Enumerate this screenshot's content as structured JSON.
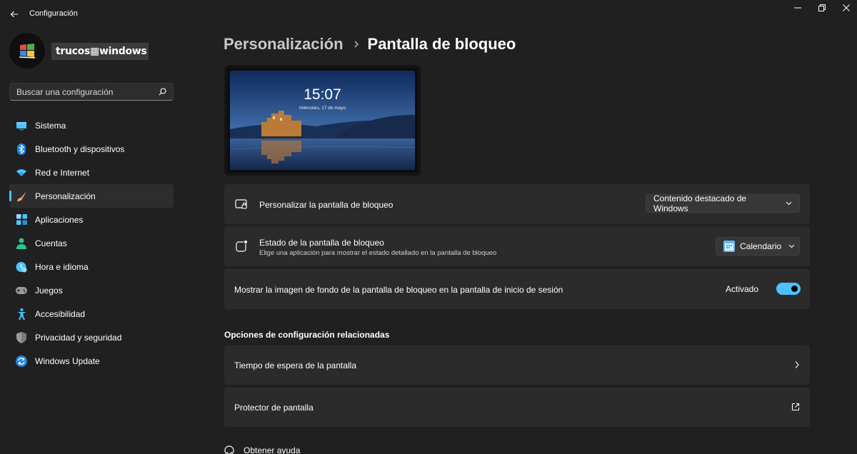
{
  "window": {
    "title": "Configuración",
    "back_icon": "back-arrow-icon",
    "controls": [
      "minimize-icon",
      "maximize-icon",
      "close-icon"
    ]
  },
  "profile": {
    "logo_text": "trucos▦windows"
  },
  "search": {
    "placeholder": "Buscar una configuración",
    "value": ""
  },
  "sidebar": {
    "accent_color": "#4cc2ff",
    "items": [
      {
        "label": "Sistema",
        "icon": "system-icon",
        "active": false
      },
      {
        "label": "Bluetooth y dispositivos",
        "icon": "bluetooth-icon",
        "active": false
      },
      {
        "label": "Red e Internet",
        "icon": "wifi-icon",
        "active": false
      },
      {
        "label": "Personalización",
        "icon": "brush-icon",
        "active": true
      },
      {
        "label": "Aplicaciones",
        "icon": "apps-icon",
        "active": false
      },
      {
        "label": "Cuentas",
        "icon": "accounts-icon",
        "active": false
      },
      {
        "label": "Hora e idioma",
        "icon": "time-language-icon",
        "active": false
      },
      {
        "label": "Juegos",
        "icon": "gamepad-icon",
        "active": false
      },
      {
        "label": "Accesibilidad",
        "icon": "accessibility-icon",
        "active": false
      },
      {
        "label": "Privacidad y seguridad",
        "icon": "shield-icon",
        "active": false
      },
      {
        "label": "Windows Update",
        "icon": "update-icon",
        "active": false
      }
    ]
  },
  "breadcrumb": {
    "parent": "Personalización",
    "current": "Pantalla de bloqueo"
  },
  "preview": {
    "time": "15:07",
    "date": "miércoles, 17 de mayo"
  },
  "settings": {
    "personalize": {
      "label": "Personalizar la pantalla de bloqueo",
      "value": "Contenido destacado de Windows"
    },
    "status": {
      "label": "Estado de la pantalla de bloqueo",
      "description": "Elige una aplicación para mostrar el estado detallado en la pantalla de bloqueo",
      "value": "Calendario"
    },
    "show_background": {
      "label": "Mostrar la imagen de fondo de la pantalla de bloqueo en la pantalla de inicio de sesión",
      "state_label": "Activado",
      "on": true
    }
  },
  "related": {
    "title": "Opciones de configuración relacionadas",
    "items": [
      {
        "label": "Tiempo de espera de la pantalla",
        "icon": "chevron-right-icon"
      },
      {
        "label": "Protector de pantalla",
        "icon": "external-link-icon"
      }
    ]
  },
  "help": {
    "label": "Obtener ayuda"
  }
}
